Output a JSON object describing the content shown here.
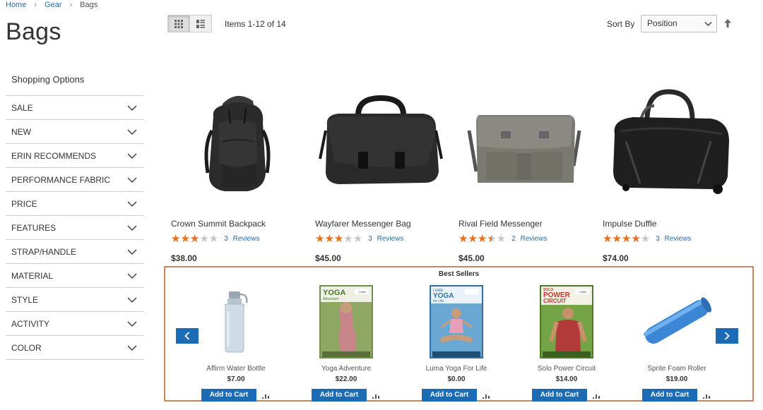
{
  "breadcrumb": {
    "items": [
      {
        "label": "Home"
      },
      {
        "label": "Gear"
      }
    ],
    "current": "Bags"
  },
  "page": {
    "title": "Bags"
  },
  "sidebar": {
    "title": "Shopping Options",
    "filters": [
      {
        "label": "SALE"
      },
      {
        "label": "NEW"
      },
      {
        "label": "ERIN RECOMMENDS"
      },
      {
        "label": "PERFORMANCE FABRIC"
      },
      {
        "label": "PRICE"
      },
      {
        "label": "FEATURES"
      },
      {
        "label": "STRAP/HANDLE"
      },
      {
        "label": "MATERIAL"
      },
      {
        "label": "STYLE"
      },
      {
        "label": "ACTIVITY"
      },
      {
        "label": "COLOR"
      }
    ]
  },
  "toolbar": {
    "view_modes": [
      {
        "icon": "grid-icon",
        "active": true
      },
      {
        "icon": "list-icon",
        "active": false
      }
    ],
    "amount": "Items 1-12 of 14",
    "sort_label": "Sort By",
    "sort_value": "Position",
    "sort_direction_icon": "arrow-up-icon"
  },
  "products": [
    {
      "name": "Crown Summit Backpack",
      "rating": 3,
      "reviews_count": "3",
      "reviews_label": "Reviews",
      "price": "$38.00",
      "image": "backpack-image"
    },
    {
      "name": "Wayfarer Messenger Bag",
      "rating": 3,
      "reviews_count": "3",
      "reviews_label": "Reviews",
      "price": "$45.00",
      "image": "messenger-bag-image"
    },
    {
      "name": "Rival Field Messenger",
      "rating": 3.5,
      "reviews_count": "2",
      "reviews_label": "Reviews",
      "price": "$45.00",
      "image": "field-messenger-image"
    },
    {
      "name": "Impulse Duffle",
      "rating": 4,
      "reviews_count": "3",
      "reviews_label": "Reviews",
      "price": "$74.00",
      "image": "duffle-image"
    }
  ],
  "best_sellers": {
    "title": "Best Sellers",
    "add_to_cart_label": "Add to Cart",
    "items": [
      {
        "name": "Affirm Water Bottle",
        "price": "$7.00",
        "image": "water-bottle-image"
      },
      {
        "name": "Yoga Adventure",
        "price": "$22.00",
        "image": "yoga-adventure-dvd-image",
        "cover_title": "YOGA",
        "cover_subtitle": "Adventure",
        "brand": "LUMA"
      },
      {
        "name": "Luma Yoga For Life",
        "price": "$0.00",
        "image": "yoga-for-life-dvd-image",
        "cover_title": "YOGA",
        "cover_subtitle": "for Life",
        "brand": "LUMA"
      },
      {
        "name": "Solo Power Circuit",
        "price": "$14.00",
        "image": "power-circuit-dvd-image",
        "cover_title": "POWER",
        "cover_subtitle": "CIRCUIT",
        "cover_top": "SOLO",
        "brand": "LUMA"
      },
      {
        "name": "Sprite Foam Roller",
        "price": "$19.00",
        "image": "foam-roller-image"
      }
    ]
  },
  "colors": {
    "link": "#2d6ca2",
    "star_filled": "#e8701a",
    "star_empty": "#c7c7c7",
    "button_blue": "#1b6bb5",
    "highlight_border": "#c98660"
  }
}
